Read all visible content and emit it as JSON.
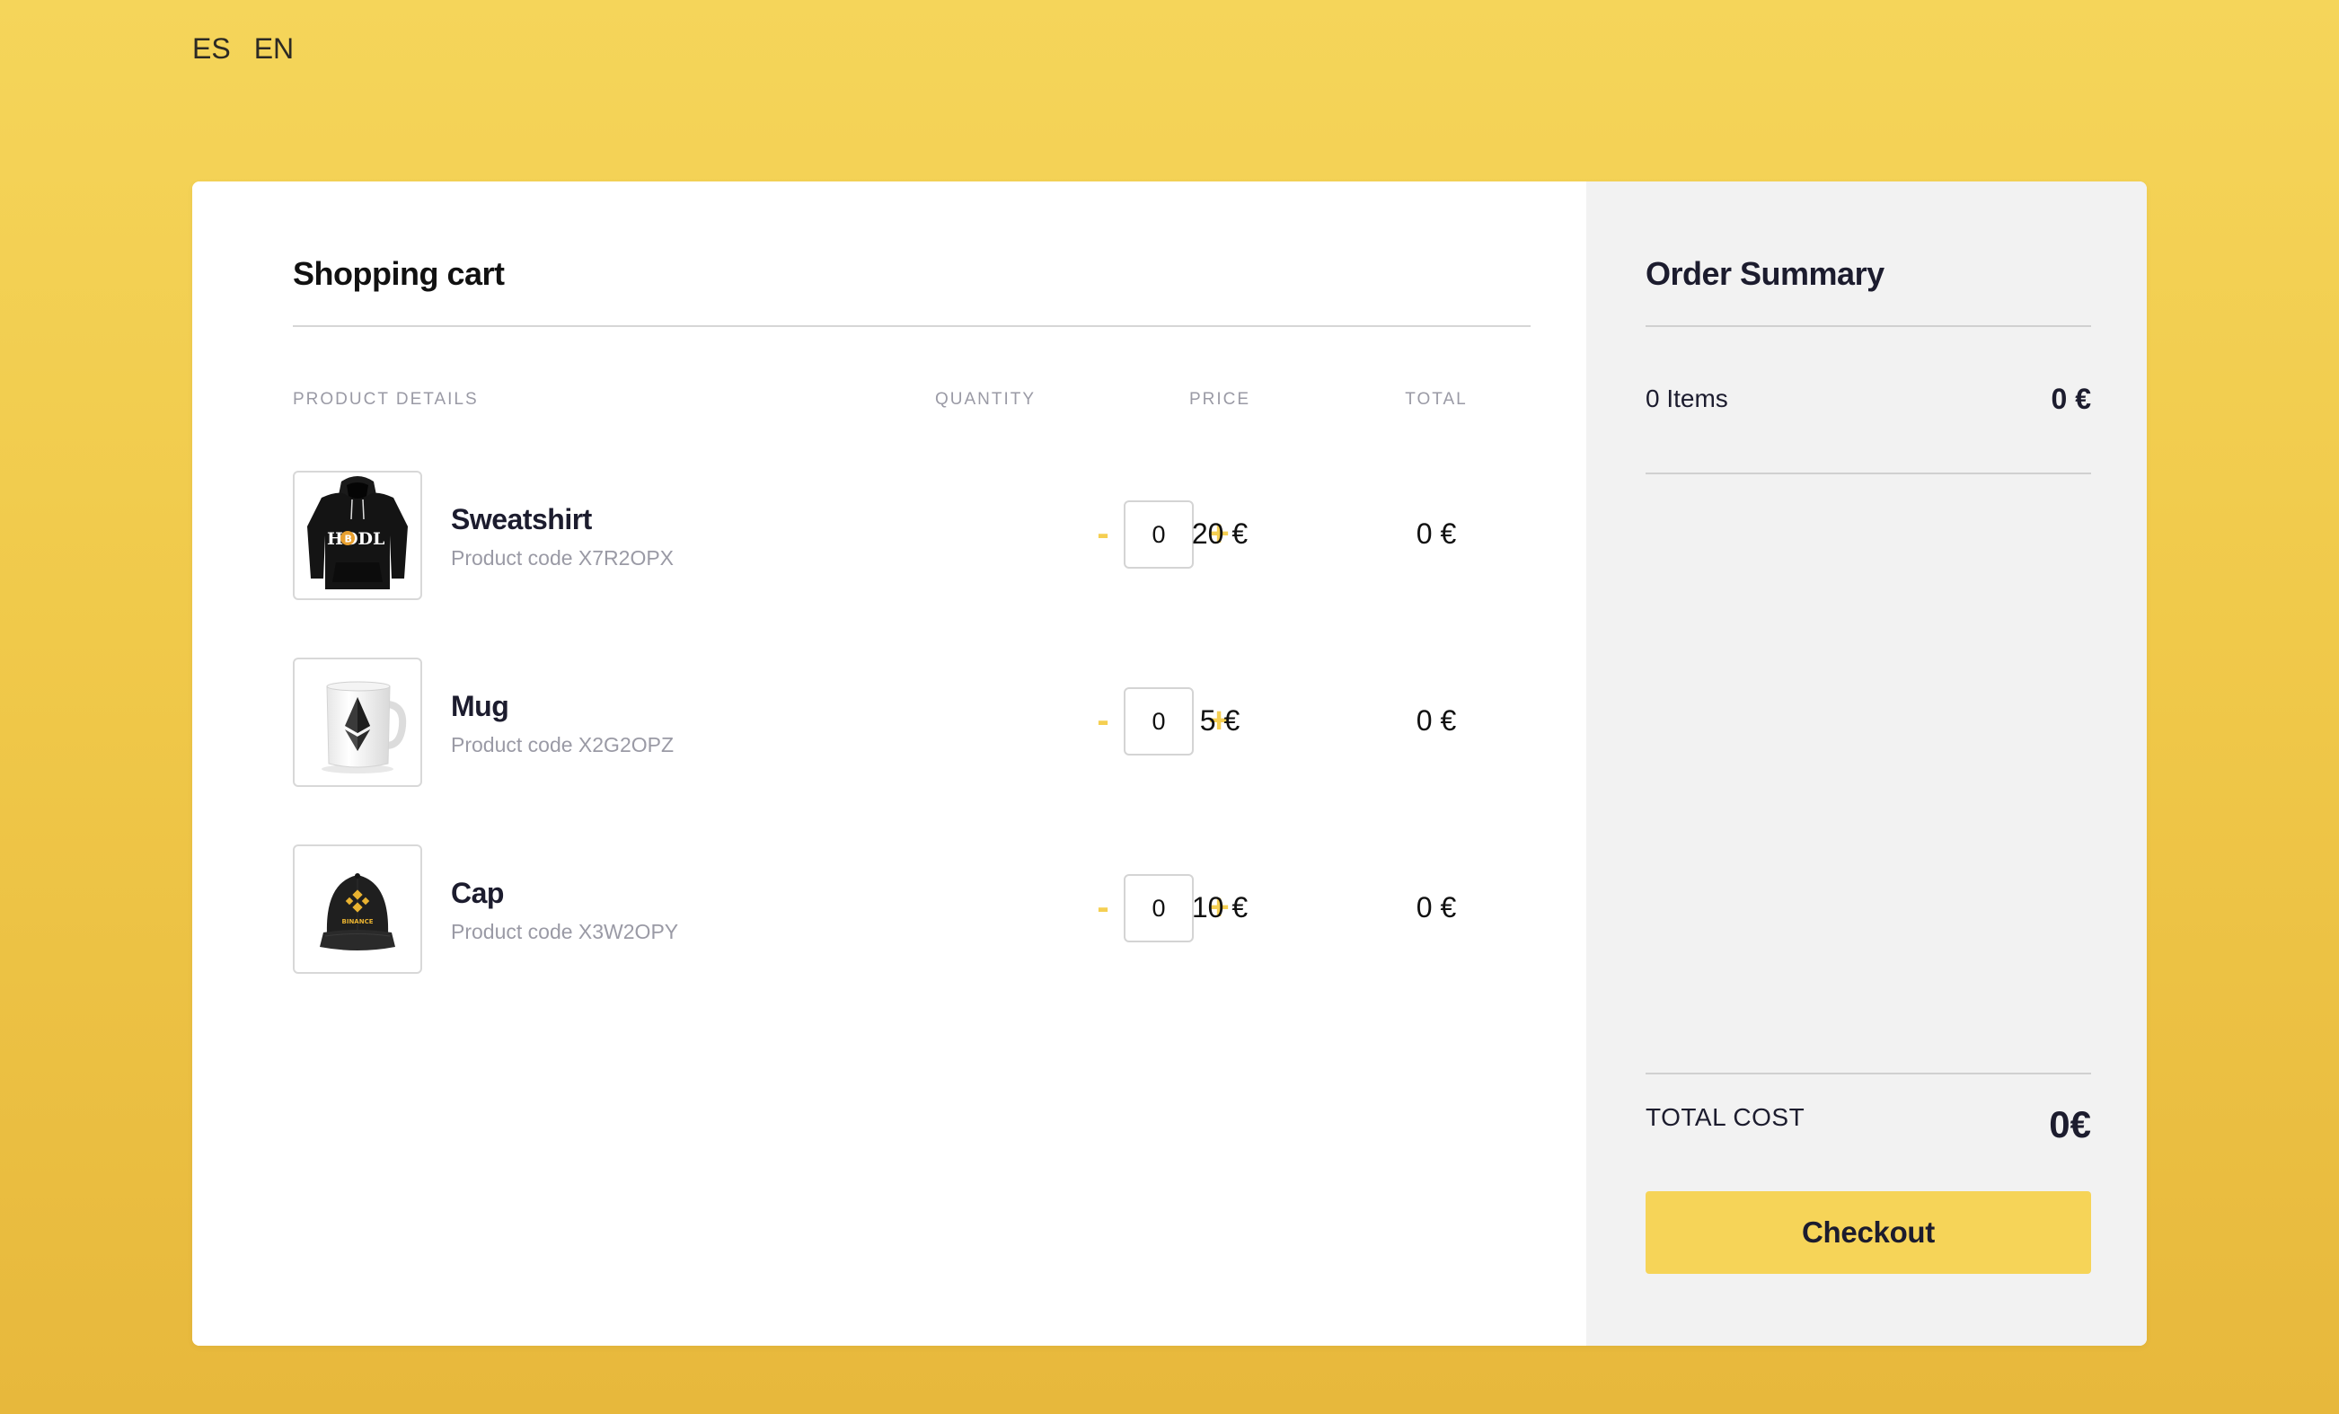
{
  "languages": [
    "ES",
    "EN"
  ],
  "cart": {
    "title": "Shopping cart",
    "columns": {
      "details": "PRODUCT DETAILS",
      "quantity": "QUANTITY",
      "price": "PRICE",
      "total": "TOTAL"
    },
    "controls": {
      "minus": "-",
      "plus": "+"
    },
    "items": [
      {
        "name": "Sweatshirt",
        "code": "Product code X7R2OPX",
        "quantity": "0",
        "price": "20 €",
        "total": "0 €",
        "image_icon": "hodl-sweatshirt-icon"
      },
      {
        "name": "Mug",
        "code": "Product code X2G2OPZ",
        "quantity": "0",
        "price": "5 €",
        "total": "0 €",
        "image_icon": "ethereum-mug-icon"
      },
      {
        "name": "Cap",
        "code": "Product code X3W2OPY",
        "quantity": "0",
        "price": "10 €",
        "total": "0 €",
        "image_icon": "binance-cap-icon"
      }
    ],
    "product_logos": {
      "sweatshirt_print": "HODL",
      "cap_print": "BINANCE"
    }
  },
  "summary": {
    "title": "Order Summary",
    "items_label": "0 Items",
    "items_value": "0 €",
    "total_label": "TOTAL COST",
    "total_value": "0€",
    "checkout_label": "Checkout"
  },
  "colors": {
    "background": "#f0c94a",
    "accent": "#f6d458",
    "summary_panel": "#f2f2f2",
    "text_dark": "#1c1c2e",
    "text_muted": "#9a9aa5"
  }
}
